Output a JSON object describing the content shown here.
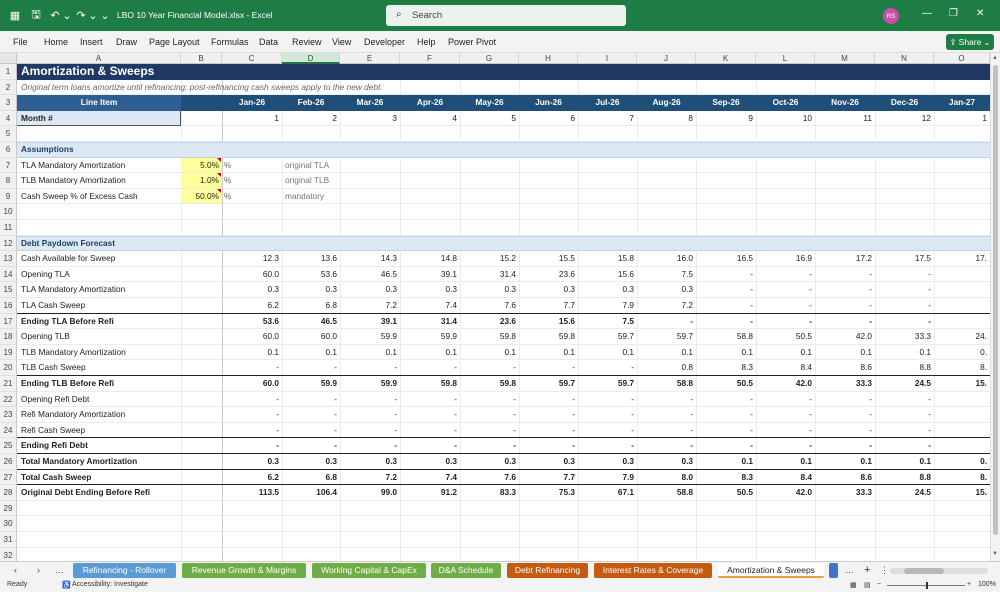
{
  "app": {
    "file_title": "LBO 10 Year Financial Model.xlsx  -  Excel",
    "search_placeholder": "Search",
    "user_initials": "RS",
    "share_label": "Share"
  },
  "ribbon_tabs": [
    "File",
    "Home",
    "Insert",
    "Draw",
    "Page Layout",
    "Formulas",
    "Data",
    "Review",
    "View",
    "Developer",
    "Help",
    "Power Pivot"
  ],
  "columns": [
    "A",
    "B",
    "C",
    "D",
    "E",
    "F",
    "G",
    "H",
    "I",
    "J",
    "K",
    "L",
    "M",
    "N",
    "O"
  ],
  "rows": [
    "1",
    "2",
    "3",
    "4",
    "5",
    "6",
    "7",
    "8",
    "9",
    "10",
    "11",
    "12",
    "13",
    "14",
    "15",
    "16",
    "17",
    "18",
    "19",
    "20",
    "21",
    "22",
    "23",
    "24",
    "25",
    "26",
    "27",
    "28",
    "29",
    "30",
    "31",
    "32"
  ],
  "sheet": {
    "title": "Amortization & Sweeps",
    "subtitle": "Original term loans amortize until refinancing; post-refinancing cash sweeps apply to the new debt.",
    "line_item_header": "Line Item",
    "months_header": [
      "Jan-26",
      "Feb-26",
      "Mar-26",
      "Apr-26",
      "May-26",
      "Jun-26",
      "Jul-26",
      "Aug-26",
      "Sep-26",
      "Oct-26",
      "Nov-26",
      "Dec-26",
      "Jan-27"
    ],
    "month_label": "Month #",
    "month_numbers": [
      "1",
      "2",
      "3",
      "4",
      "5",
      "6",
      "7",
      "8",
      "9",
      "10",
      "11",
      "12",
      "1"
    ],
    "assumptions_label": "Assumptions",
    "assumptions": [
      {
        "label": "TLA Mandatory Amortization",
        "value": "5.0%",
        "unit": "%",
        "note": "original TLA"
      },
      {
        "label": "TLB Mandatory Amortization",
        "value": "1.0%",
        "unit": "%",
        "note": "original TLB"
      },
      {
        "label": "Cash Sweep % of Excess Cash",
        "value": "50.0%",
        "unit": "%",
        "note": "mandatory"
      }
    ],
    "forecast_label": "Debt Paydown Forecast",
    "forecast_rows": [
      {
        "row": 13,
        "label": "Cash Available for Sweep",
        "bold": false,
        "border": false,
        "values": [
          "12.3",
          "13.6",
          "14.3",
          "14.8",
          "15.2",
          "15.5",
          "15.8",
          "16.0",
          "16.5",
          "16.9",
          "17.2",
          "17.5",
          "17."
        ]
      },
      {
        "row": 14,
        "label": "Opening TLA",
        "bold": false,
        "border": false,
        "values": [
          "60.0",
          "53.6",
          "46.5",
          "39.1",
          "31.4",
          "23.6",
          "15.6",
          "7.5",
          "-",
          "-",
          "-",
          "-",
          ""
        ]
      },
      {
        "row": 15,
        "label": "TLA Mandatory Amortization",
        "bold": false,
        "border": false,
        "values": [
          "0.3",
          "0.3",
          "0.3",
          "0.3",
          "0.3",
          "0.3",
          "0.3",
          "0.3",
          "-",
          "-",
          "-",
          "-",
          ""
        ]
      },
      {
        "row": 16,
        "label": "TLA Cash Sweep",
        "bold": false,
        "border": false,
        "values": [
          "6.2",
          "6.8",
          "7.2",
          "7.4",
          "7.6",
          "7.7",
          "7.9",
          "7.2",
          "-",
          "-",
          "-",
          "-",
          ""
        ]
      },
      {
        "row": 17,
        "label": "Ending TLA Before Refi",
        "bold": true,
        "border": true,
        "values": [
          "53.6",
          "46.5",
          "39.1",
          "31.4",
          "23.6",
          "15.6",
          "7.5",
          "-",
          "-",
          "-",
          "-",
          "-",
          ""
        ]
      },
      {
        "row": 18,
        "label": "Opening TLB",
        "bold": false,
        "border": false,
        "values": [
          "60.0",
          "60.0",
          "59.9",
          "59.9",
          "59.8",
          "59.8",
          "59.7",
          "59.7",
          "58.8",
          "50.5",
          "42.0",
          "33.3",
          "24."
        ]
      },
      {
        "row": 19,
        "label": "TLB Mandatory Amortization",
        "bold": false,
        "border": false,
        "values": [
          "0.1",
          "0.1",
          "0.1",
          "0.1",
          "0.1",
          "0.1",
          "0.1",
          "0.1",
          "0.1",
          "0.1",
          "0.1",
          "0.1",
          "0."
        ]
      },
      {
        "row": 20,
        "label": "TLB Cash Sweep",
        "bold": false,
        "border": false,
        "values": [
          "-",
          "-",
          "-",
          "-",
          "-",
          "-",
          "-",
          "0.8",
          "8.3",
          "8.4",
          "8.6",
          "8.8",
          "8."
        ]
      },
      {
        "row": 21,
        "label": "Ending TLB Before Refi",
        "bold": true,
        "border": true,
        "values": [
          "60.0",
          "59.9",
          "59.9",
          "59.8",
          "59.8",
          "59.7",
          "59.7",
          "58.8",
          "50.5",
          "42.0",
          "33.3",
          "24.5",
          "15."
        ]
      },
      {
        "row": 22,
        "label": "Opening Refi Debt",
        "bold": false,
        "border": false,
        "values": [
          "-",
          "-",
          "-",
          "-",
          "-",
          "-",
          "-",
          "-",
          "-",
          "-",
          "-",
          "-",
          ""
        ]
      },
      {
        "row": 23,
        "label": "Refi Mandatory Amortization",
        "bold": false,
        "border": false,
        "values": [
          "-",
          "-",
          "-",
          "-",
          "-",
          "-",
          "-",
          "-",
          "-",
          "-",
          "-",
          "-",
          ""
        ]
      },
      {
        "row": 24,
        "label": "Refi Cash Sweep",
        "bold": false,
        "border": false,
        "values": [
          "-",
          "-",
          "-",
          "-",
          "-",
          "-",
          "-",
          "-",
          "-",
          "-",
          "-",
          "-",
          ""
        ]
      },
      {
        "row": 25,
        "label": "Ending Refi Debt",
        "bold": true,
        "border": true,
        "values": [
          "-",
          "-",
          "-",
          "-",
          "-",
          "-",
          "-",
          "-",
          "-",
          "-",
          "-",
          "-",
          ""
        ]
      },
      {
        "row": 26,
        "label": "Total Mandatory Amortization",
        "bold": true,
        "border": true,
        "values": [
          "0.3",
          "0.3",
          "0.3",
          "0.3",
          "0.3",
          "0.3",
          "0.3",
          "0.3",
          "0.1",
          "0.1",
          "0.1",
          "0.1",
          "0."
        ]
      },
      {
        "row": 27,
        "label": "Total Cash Sweep",
        "bold": true,
        "border": true,
        "values": [
          "6.2",
          "6.8",
          "7.2",
          "7.4",
          "7.6",
          "7.7",
          "7.9",
          "8.0",
          "8.3",
          "8.4",
          "8.6",
          "8.8",
          "8."
        ]
      },
      {
        "row": 28,
        "label": "Original Debt Ending Before Refi",
        "bold": true,
        "border": true,
        "values": [
          "113.5",
          "106.4",
          "99.0",
          "91.2",
          "83.3",
          "75.3",
          "67.1",
          "58.8",
          "50.5",
          "42.0",
          "33.3",
          "24.5",
          "15."
        ]
      }
    ]
  },
  "sheet_tabs": [
    {
      "name": "Refinancing - Rollover",
      "color": "#5b9bd5",
      "active": false
    },
    {
      "name": "Revenue Growth & Margins",
      "color": "#70ad47",
      "active": false
    },
    {
      "name": "Working Capital & CapEx",
      "color": "#70ad47",
      "active": false
    },
    {
      "name": "D&A Schedule",
      "color": "#70ad47",
      "active": false
    },
    {
      "name": "Debt Refinancing",
      "color": "#c55a11",
      "active": false
    },
    {
      "name": "Interest Rates & Coverage",
      "color": "#c55a11",
      "active": false
    },
    {
      "name": "Amortization & Sweeps",
      "color": "#ffffff",
      "active": true
    }
  ],
  "status": {
    "ready": "Ready",
    "accessibility": "Accessibility: Investigate",
    "zoom": "100%"
  }
}
